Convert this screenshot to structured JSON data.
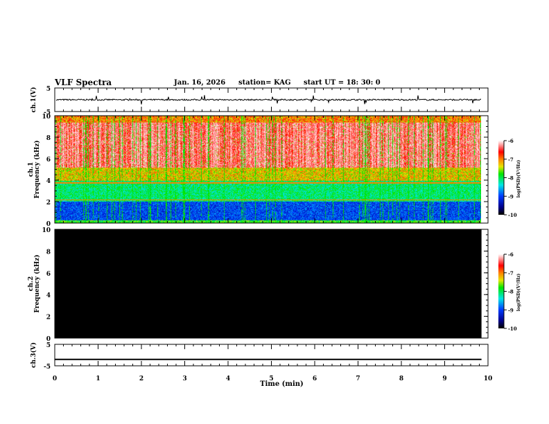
{
  "header": {
    "title": "VLF Spectra",
    "date": "Jan. 16, 2026",
    "station": "station= KAG",
    "start": "start  UT =   18: 30: 0"
  },
  "chart_data": [
    {
      "type": "line",
      "panel": "ch.1",
      "ylabel": "ch.1(V)",
      "ylim": [
        -5,
        5
      ],
      "yticks": [
        "5",
        "-5"
      ],
      "xlim": [
        0,
        10
      ],
      "description_values": "waveform near 0 V with small spikes"
    },
    {
      "type": "heatmap",
      "panel": "ch.1 spectrogram",
      "ylabel": "ch.1\nFrequency (kHz)",
      "ylim": [
        0,
        10
      ],
      "yticks": [
        "0",
        "2",
        "4",
        "6",
        "8",
        "10"
      ],
      "xlim": [
        0,
        10
      ],
      "colorbar": {
        "label": "log(PSD)(V²/Hz)",
        "range": [
          -10,
          -6
        ],
        "ticks": [
          "-6",
          "-7",
          "-8",
          "-9",
          "-10"
        ]
      }
    },
    {
      "type": "heatmap",
      "panel": "ch.2 spectrogram",
      "ylabel": "ch.2\nFrequency (kHz)",
      "ylim": [
        0,
        10
      ],
      "yticks": [
        "0",
        "2",
        "4",
        "6",
        "8",
        "10"
      ],
      "xlim": [
        0,
        10
      ],
      "fill": "#000000",
      "colorbar": {
        "label": "log(PSD)(V²/Hz)",
        "range": [
          -10,
          -6
        ],
        "ticks": [
          "-6",
          "-7",
          "-8",
          "-9",
          "-10"
        ]
      }
    },
    {
      "type": "line",
      "panel": "ch.3",
      "ylabel": "ch.3(V)",
      "ylim": [
        -5,
        5
      ],
      "yticks": [
        "5",
        "-5"
      ],
      "xlim": [
        0,
        10
      ],
      "constant_value": -2
    }
  ],
  "xaxis": {
    "label": "Time (min)",
    "ticks": [
      "0",
      "1",
      "2",
      "3",
      "4",
      "5",
      "6",
      "7",
      "8",
      "9",
      "10"
    ],
    "data_end": 9.85
  }
}
